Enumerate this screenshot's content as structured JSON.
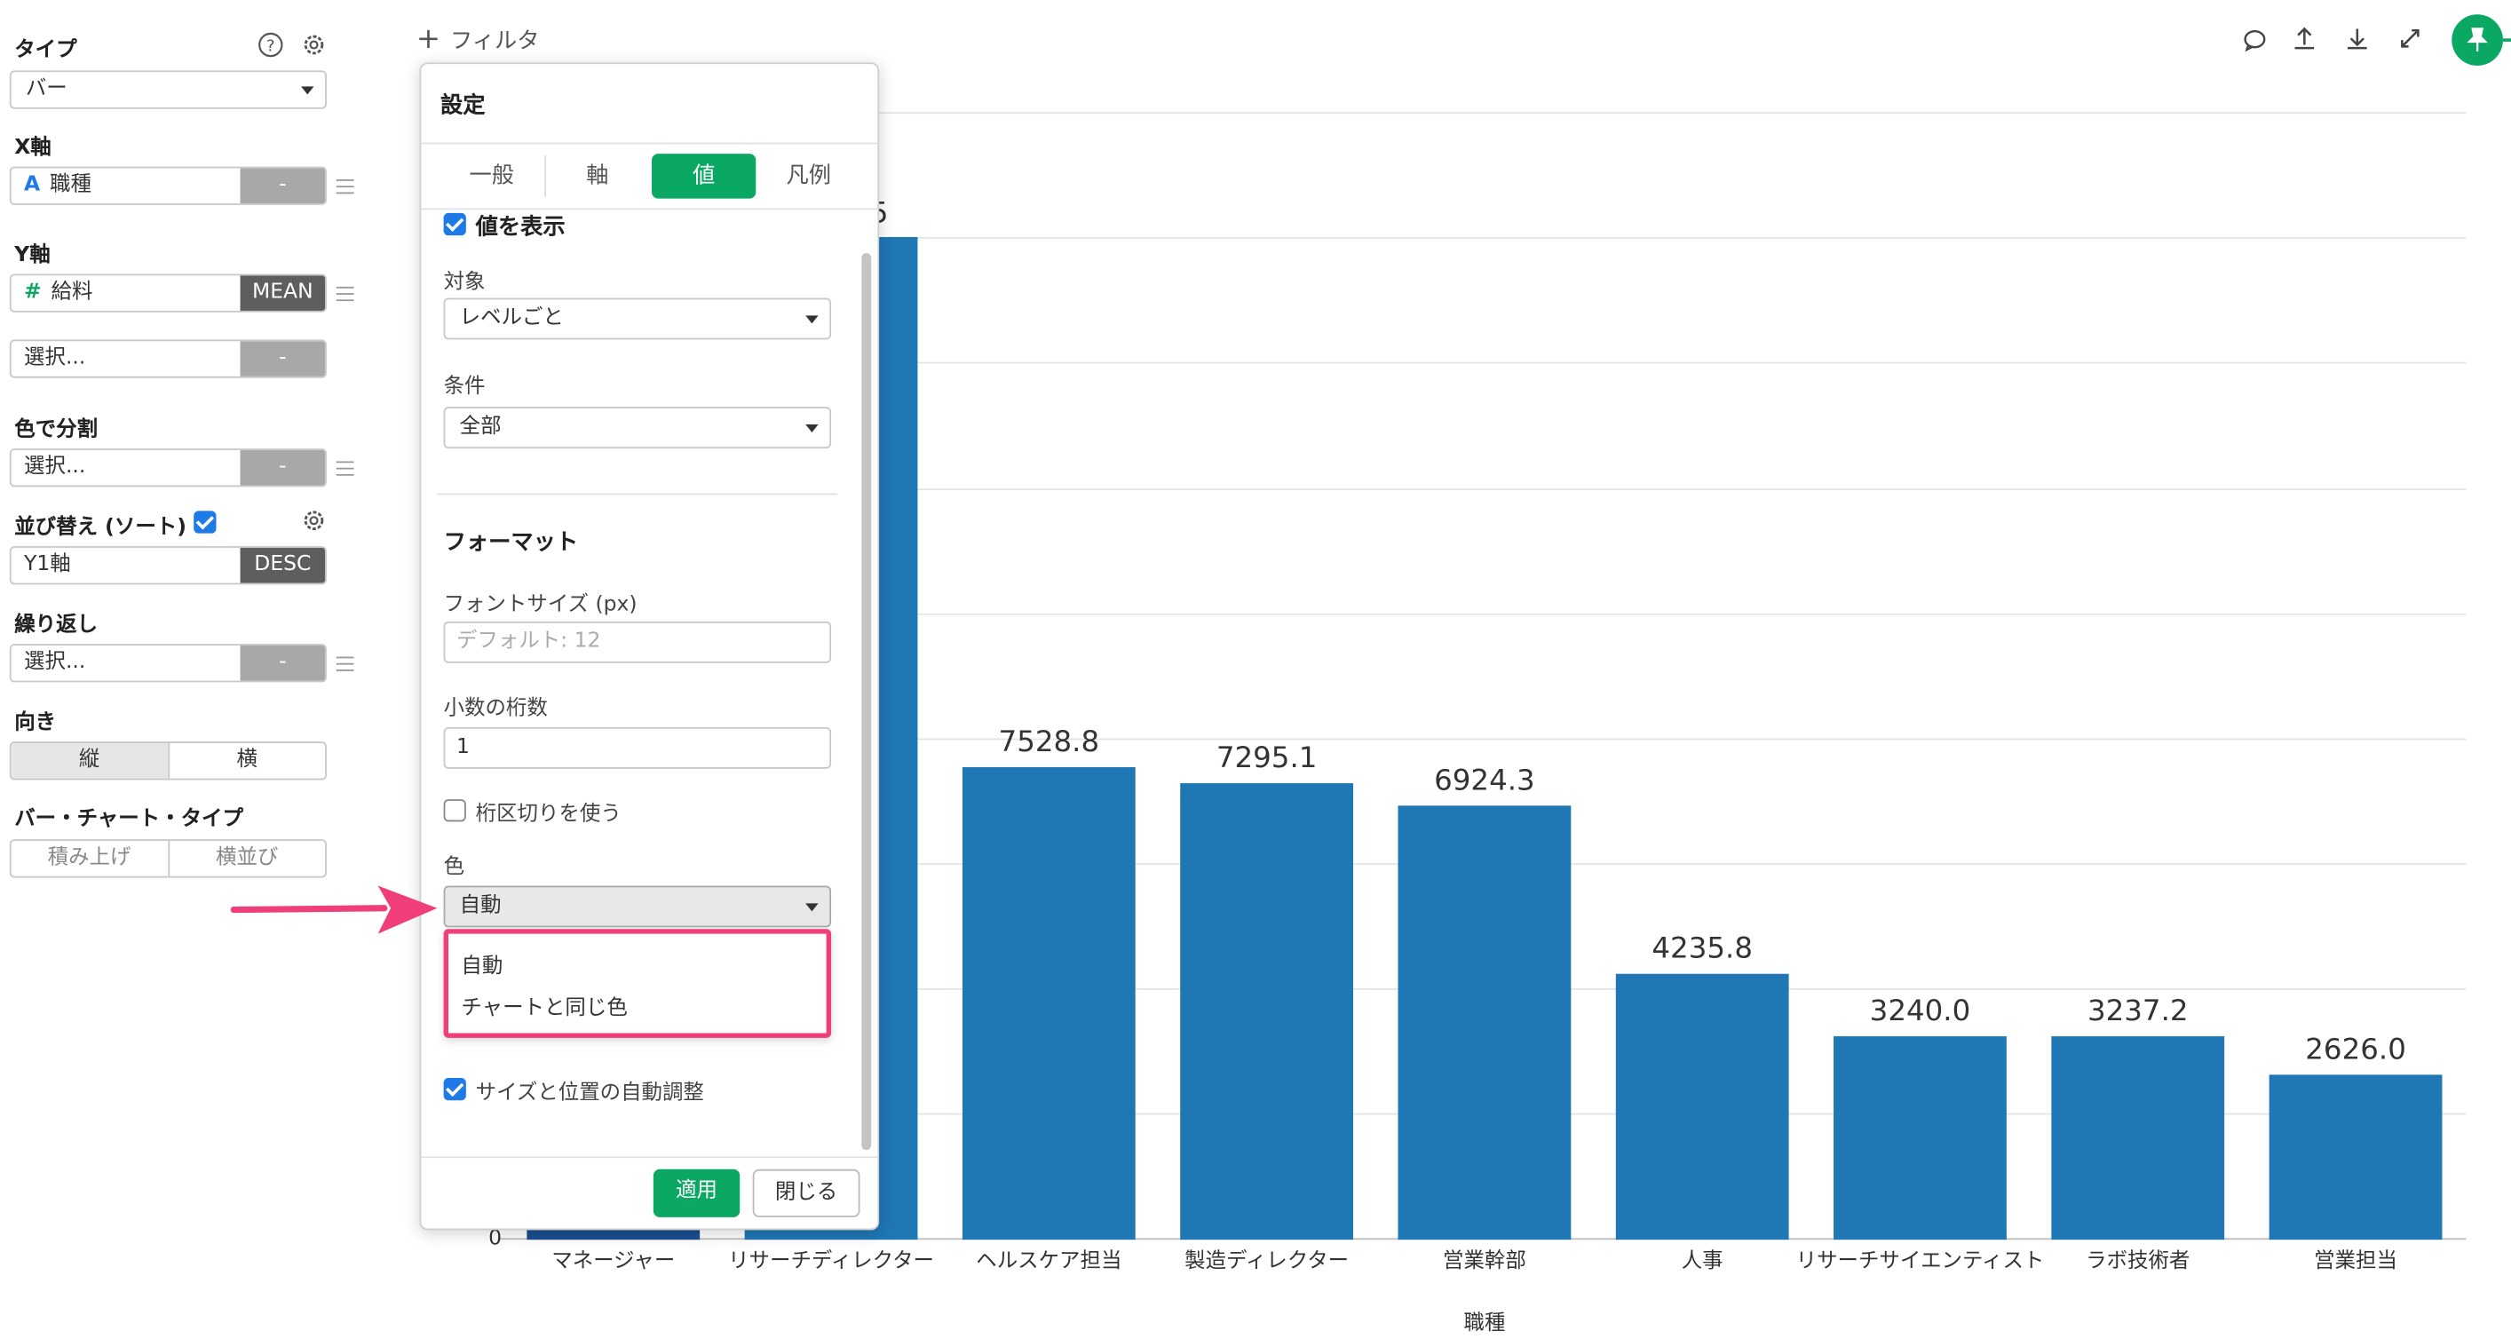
{
  "toolbar": {
    "filter_label": "フィルタ"
  },
  "sidebar": {
    "type_label": "タイプ",
    "type_value": "バー",
    "x_axis_label": "X軸",
    "x_field": "職種",
    "x_field_agg": "-",
    "y_axis_label": "Y軸",
    "y_field": "給料",
    "y_field_agg": "MEAN",
    "y2_placeholder": "選択...",
    "y2_agg": "-",
    "color_split_label": "色で分割",
    "color_placeholder": "選択...",
    "color_agg": "-",
    "sort_label": "並び替え (ソート)",
    "sort_field": "Y1軸",
    "sort_order": "DESC",
    "repeat_label": "繰り返し",
    "repeat_placeholder": "選択...",
    "repeat_agg": "-",
    "orientation_label": "向き",
    "orientation_vertical": "縦",
    "orientation_horizontal": "横",
    "bar_type_label": "バー・チャート・タイプ",
    "bar_type_stacked": "積み上げ",
    "bar_type_side": "横並び"
  },
  "dialog": {
    "title": "設定",
    "tabs": [
      "一般",
      "軸",
      "値",
      "凡例"
    ],
    "active_tab": "値",
    "show_values_label": "値を表示",
    "target_label": "対象",
    "target_value": "レベルごと",
    "condition_label": "条件",
    "condition_value": "全部",
    "format_heading": "フォーマット",
    "font_size_label": "フォントサイズ (px)",
    "font_size_placeholder": "デフォルト: 12",
    "decimals_label": "小数の桁数",
    "decimals_value": "1",
    "thousands_label": "桁区切りを使う",
    "color_label": "色",
    "color_value": "自動",
    "color_options": [
      "自動",
      "チャートと同じ色"
    ],
    "auto_adjust_label": "サイズと位置の自動調整",
    "apply_label": "適用",
    "close_label": "閉じる"
  },
  "colors": {
    "accent": "#0ba864",
    "bar": "#1f77b4",
    "highlight": "#ef3e7a"
  },
  "chart_data": {
    "type": "bar",
    "xlabel": "職種",
    "categories": [
      "マネージャー",
      "リサーチディレクター",
      "ヘルスケア担当",
      "製造ディレクター",
      "営業幹部",
      "人事",
      "リサーチサイエンティスト",
      "ラボ技術者",
      "営業担当"
    ],
    "values": [
      null,
      null,
      7528.8,
      7295.1,
      6924.3,
      4235.8,
      3240.0,
      3237.2,
      2626.0
    ],
    "data_labels": [
      "",
      "",
      "7528.8",
      "7295.1",
      "6924.3",
      "4235.8",
      "3240.0",
      "3237.2",
      "2626.0"
    ],
    "ylim": [
      0,
      16000
    ],
    "y_tick_shown": "0",
    "grid": true
  }
}
